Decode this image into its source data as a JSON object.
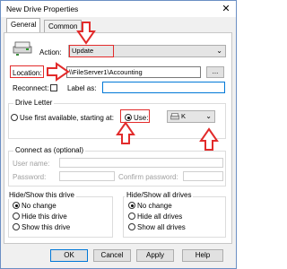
{
  "window": {
    "title": "New Drive Properties",
    "close_glyph": "✕"
  },
  "tabs": [
    {
      "label": "General"
    },
    {
      "label": "Common"
    }
  ],
  "action": {
    "label": "Action:",
    "value": "Update"
  },
  "location": {
    "label": "Location:",
    "value": "\\\\FileServer1\\Accounting",
    "browse_label": "..."
  },
  "reconnect": {
    "label": "Reconnect:",
    "checked": false
  },
  "label_as": {
    "label": "Label as:",
    "value": ""
  },
  "drive_letter": {
    "legend": "Drive Letter",
    "use_first_label": "Use first available, starting at:",
    "use_label": "Use:",
    "selected_drive": "K"
  },
  "connect_as": {
    "legend": "Connect as (optional)",
    "user_label": "User name:",
    "password_label": "Password:",
    "confirm_label": "Confirm password:"
  },
  "hide_show_drive": {
    "legend": "Hide/Show this drive",
    "options": [
      "No change",
      "Hide this drive",
      "Show this drive"
    ]
  },
  "hide_show_all": {
    "legend": "Hide/Show all drives",
    "options": [
      "No change",
      "Hide all drives",
      "Show all drives"
    ]
  },
  "buttons": {
    "ok": "OK",
    "cancel": "Cancel",
    "apply": "Apply",
    "help": "Help"
  },
  "colors": {
    "highlight": "#e22b2b",
    "accent": "#0078d7"
  }
}
